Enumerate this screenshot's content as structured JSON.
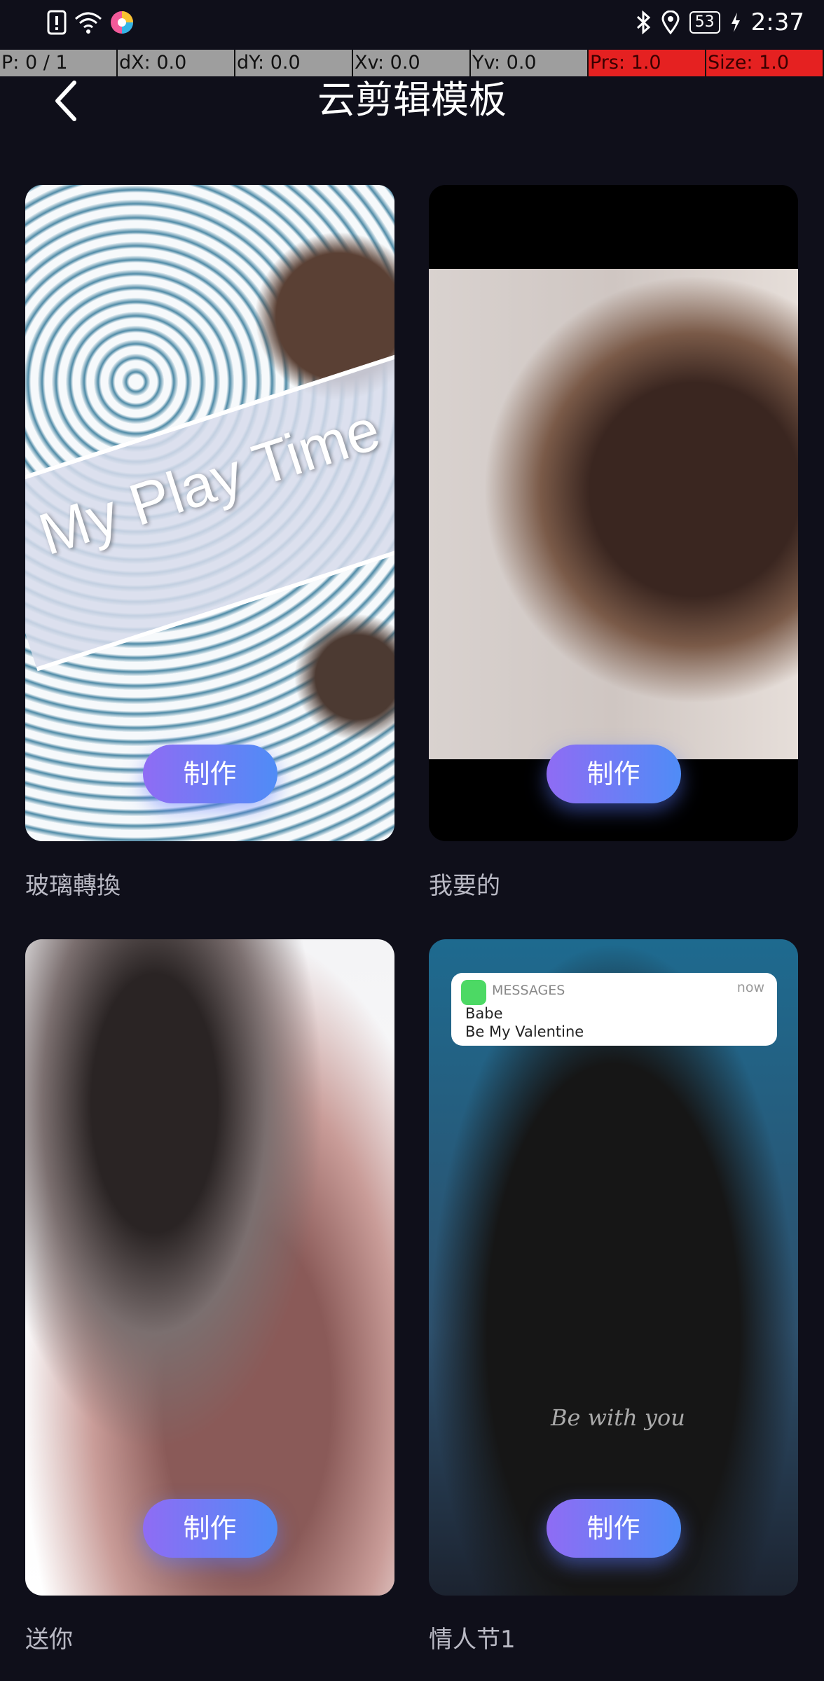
{
  "status_bar": {
    "time": "2:37",
    "battery": "53"
  },
  "debug_bar": {
    "cells": [
      "P: 0 / 1",
      "dX: 0.0",
      "dY: 0.0",
      "Xv: 0.0",
      "Yv: 0.0",
      "Prs: 1.0",
      "Size: 1.0"
    ]
  },
  "header": {
    "title": "云剪辑模板"
  },
  "templates": [
    {
      "label": "玻璃轉換",
      "button": "制作",
      "overlay_text": "My Play Time"
    },
    {
      "label": "我要的",
      "button": "制作"
    },
    {
      "label": "送你",
      "button": "制作"
    },
    {
      "label": "情人节1",
      "button": "制作",
      "notification": {
        "app": "MESSAGES",
        "time": "now",
        "sender": "Babe",
        "message": "Be  My  Valentine"
      },
      "caption": "Be with you"
    }
  ],
  "colors": {
    "background": "#0f0f1a",
    "button_start": "#8f6cf4",
    "button_end": "#4f8cf6",
    "debug_gray": "#9e9e9e",
    "debug_red": "#e52121"
  }
}
